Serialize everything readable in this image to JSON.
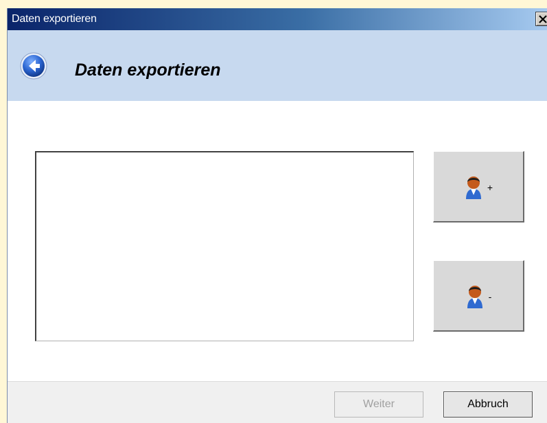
{
  "window": {
    "title": "Daten exportieren",
    "close_glyph": "✕"
  },
  "header": {
    "title": "Daten exportieren",
    "back_icon": "back-arrow-icon"
  },
  "main": {
    "list_items": [],
    "add_button": {
      "icon": "user-icon",
      "symbol": "+"
    },
    "remove_button": {
      "icon": "user-icon",
      "symbol": "-"
    }
  },
  "footer": {
    "next_label": "Weiter",
    "next_enabled": false,
    "cancel_label": "Abbruch"
  },
  "colors": {
    "header_bg": "#c7d9ef",
    "titlebar_start": "#0a246a",
    "titlebar_end": "#a6caf0",
    "accent_blue": "#1f5fbf"
  }
}
